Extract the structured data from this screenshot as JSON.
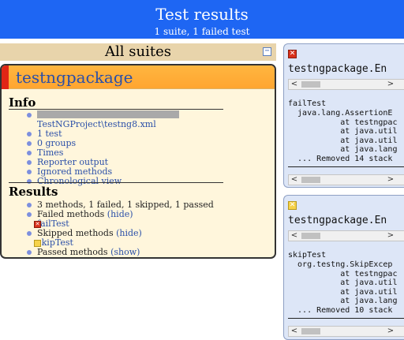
{
  "header": {
    "title": "Test results",
    "subtitle": "1 suite, 1 failed test"
  },
  "navigator": {
    "suites_title": "All suites",
    "collapse_glyph": "−",
    "suite": {
      "name": "testngpackage",
      "info_title": "Info",
      "config_path_tail": "TestNGProject\\testng8.xml",
      "info_links": [
        "1 test",
        "0 groups",
        "Times",
        "Reporter output",
        "Ignored methods",
        "Chronological view"
      ],
      "results_title": "Results",
      "summary": "3 methods, 1 failed, 1 skipped, 1 passed",
      "failed_label": "Failed methods",
      "failed_toggle": "(hide)",
      "failed_method": "failTest",
      "skipped_label": "Skipped methods",
      "skipped_toggle": "(hide)",
      "skipped_method": "skipTest",
      "passed_label": "Passed methods",
      "passed_toggle": "(show)"
    }
  },
  "panels": [
    {
      "status": "failed",
      "status_icon": "failed-status-icon",
      "title": "testngpackage.En",
      "method": "failTest",
      "trace": "  java.lang.AssertionE\n           at testngpac\n           at java.util\n           at java.util\n           at java.lang\n  ... Removed 14 stack"
    },
    {
      "status": "skipped",
      "status_icon": "skipped-status-icon",
      "title": "testngpackage.En",
      "method": "skipTest",
      "trace": "  org.testng.SkipExcep\n           at testngpac\n           at java.util\n           at java.util\n           at java.lang\n  ... Removed 10 stack"
    }
  ],
  "scroll": {
    "left_glyph": "<",
    "right_glyph": ">"
  },
  "colors": {
    "header_bg": "#1e66f3",
    "suite_header_bg": "#ffad35",
    "suite_flag": "#e02616",
    "link": "#2a4fa8",
    "panel_bg": "#dde6f7"
  }
}
